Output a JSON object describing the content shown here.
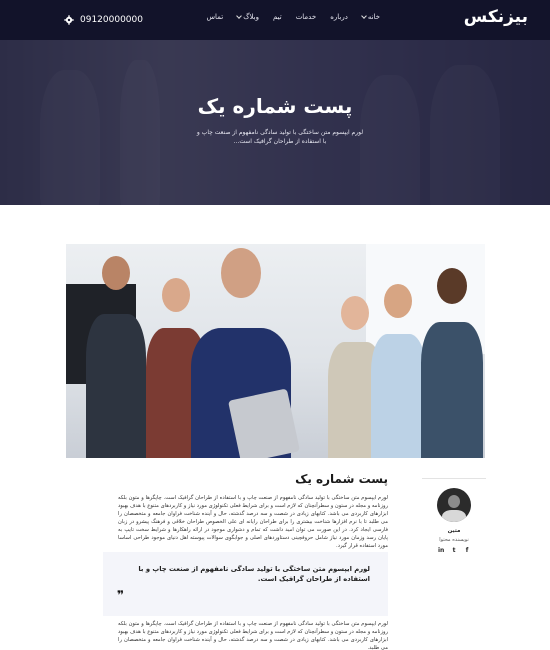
{
  "header": {
    "logo": "بیزنکس",
    "phone": "09120000000",
    "nav": [
      {
        "label": "خانه",
        "dropdown": true
      },
      {
        "label": "درباره",
        "dropdown": false
      },
      {
        "label": "خدمات",
        "dropdown": false
      },
      {
        "label": "تیم",
        "dropdown": false
      },
      {
        "label": "وبلاگ",
        "dropdown": true
      },
      {
        "label": "تماس",
        "dropdown": false
      }
    ]
  },
  "hero": {
    "title": "پست شماره یک",
    "subtitle": "لورم ایپسوم متن ساختگی با تولید سادگی نامفهوم از صنعت چاپ و با استفاده از طراحان گرافیک است..."
  },
  "post": {
    "title": "پست شماره یک",
    "paragraph1": "لورم ایپسوم متن ساختگی با تولید سادگی نامفهوم از صنعت چاپ و با استفاده از طراحان گرافیک است. چاپگرها و متون بلکه روزنامه و مجله در ستون و سطرآنچنان که لازم است و برای شرایط فعلی تکنولوژی مورد نیاز و کاربردهای متنوع با هدف بهبود ابزارهای کاربردی می باشد. کتابهای زیادی در شصت و سه درصد گذشته، حال و آینده شناخت فراوان جامعه و متخصصان را می طلبد تا با نرم افزارها شناخت بیشتری را برای طراحان رایانه ای علی الخصوص طراحان خلاقی و فرهنگ پیشرو در زبان فارسی ایجاد کرد. در این صورت می توان امید داشت که تمام و دشواری موجود در ارائه راهکارها و شرایط سخت تایپ به پایان رسد وزمان مورد نیاز شامل حروفچینی دستاوردهای اصلی و جوابگوی سوالات پیوسته اهل دنیای موجود طراحی اساسا مورد استفاده قرار گیرد.",
    "quote": "لورم ایپسوم متن ساختگی با تولید سادگی نامفهوم از صنعت چاپ و با استفاده از طراحان گرافیک است.",
    "quote_mark": "❞",
    "paragraph2": "لورم ایپسوم متن ساختگی با تولید سادگی نامفهوم از صنعت چاپ و با استفاده از طراحان گرافیک است. چاپگرها و متون بلکه روزنامه و مجله در ستون و سطرآنچنان که لازم است و برای شرایط فعلی تکنولوژی مورد نیاز و کاربردهای متنوع با هدف بهبود ابزارهای کاربردی می باشد. کتابهای زیادی در شصت و سه درصد گذشته، حال و آینده شناخت فراوان جامعه و متخصصان را می طلبد."
  },
  "author": {
    "name": "متین",
    "role": "نویسنده محتوا",
    "socials": [
      "in",
      "t",
      "f"
    ]
  },
  "colors": {
    "header_bg": "#12132a",
    "hero_overlay": "#1c1c3c",
    "quote_bg": "#f4f5fa"
  },
  "icons": {
    "settings": "gear-icon",
    "dropdown": "chevron-down-icon",
    "quote": "quote-icon",
    "linkedin": "linkedin-icon",
    "twitter": "twitter-icon",
    "facebook": "facebook-icon"
  }
}
